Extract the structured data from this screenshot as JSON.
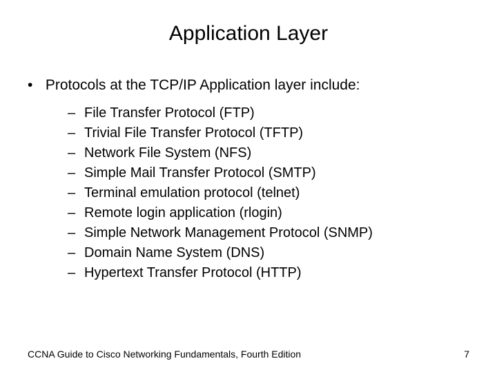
{
  "title": "Application Layer",
  "lead_bullet": "•",
  "lead_text": "Protocols at the TCP/IP Application layer include:",
  "dash": "–",
  "items": [
    "File Transfer Protocol (FTP)",
    "Trivial File Transfer Protocol (TFTP)",
    "Network File System (NFS)",
    "Simple Mail Transfer Protocol (SMTP)",
    "Terminal emulation protocol (telnet)",
    "Remote login application (rlogin)",
    "Simple Network Management Protocol (SNMP)",
    "Domain Name System (DNS)",
    "Hypertext Transfer Protocol (HTTP)"
  ],
  "footer_left": "CCNA Guide to Cisco Networking Fundamentals, Fourth Edition",
  "footer_right": "7"
}
